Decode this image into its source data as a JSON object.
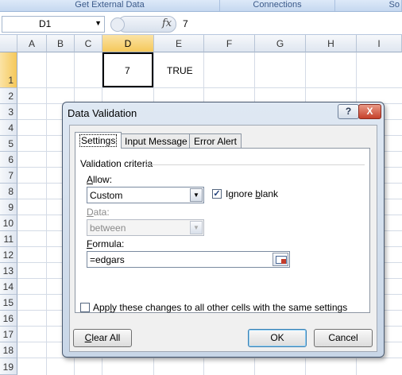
{
  "ribbon": {
    "groups": [
      {
        "label": "Get External Data"
      },
      {
        "label": "Connections"
      },
      {
        "label": "So"
      }
    ]
  },
  "formula_bar": {
    "name_box": "D1",
    "fx_label": "fx",
    "content": "7"
  },
  "grid": {
    "columns": [
      "A",
      "B",
      "C",
      "D",
      "E",
      "F",
      "G",
      "H",
      "I"
    ],
    "rows": [
      "1",
      "2",
      "3",
      "4",
      "5",
      "6",
      "7",
      "8",
      "9",
      "10",
      "11",
      "12",
      "13",
      "14",
      "15",
      "16",
      "17",
      "18",
      "19"
    ],
    "cells": {
      "D1": "7",
      "E1": "TRUE"
    }
  },
  "dialog": {
    "title": "Data Validation",
    "help_label": "?",
    "close_label": "X",
    "tabs": [
      "Settings",
      "Input Message",
      "Error Alert"
    ],
    "active_tab": "Settings",
    "group_label": "Validation criteria",
    "allow": {
      "label_pre": "",
      "label_ul": "A",
      "label_post": "llow:",
      "value": "Custom"
    },
    "ignore_blank": {
      "label_pre": "Ignore ",
      "label_ul": "b",
      "label_post": "lank",
      "checked": true,
      "check_glyph": "✓"
    },
    "data": {
      "label_pre": "",
      "label_ul": "D",
      "label_post": "ata:",
      "value": "between",
      "disabled": true
    },
    "formula": {
      "label_pre": "",
      "label_ul": "F",
      "label_post": "ormula:",
      "value": "=edgars"
    },
    "apply_all": {
      "label_pre": "App",
      "label_ul": "l",
      "label_post": "y these changes to all other cells with the same settings",
      "checked": false
    },
    "buttons": {
      "clear_all_ul": "C",
      "clear_all_post": "lear All",
      "ok": "OK",
      "cancel": "Cancel"
    },
    "dropdown_glyph": "▼"
  }
}
